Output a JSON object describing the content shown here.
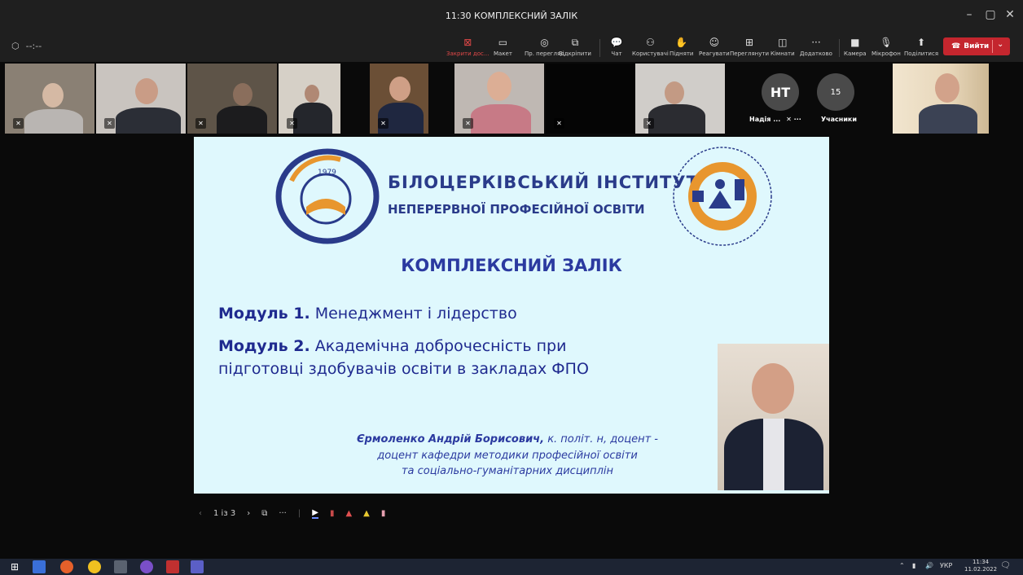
{
  "window": {
    "title": "11:30 КОМПЛЕКСНИЙ ЗАЛІК"
  },
  "toolbar": {
    "timer": "--:--",
    "buttons": [
      {
        "label": "Закрити дос...",
        "icon": "close-share-icon"
      },
      {
        "label": "Макет",
        "icon": "layout-icon"
      },
      {
        "label": "Пр. перегляд",
        "icon": "eye-icon"
      },
      {
        "label": "Відкріпити",
        "icon": "unpin-icon"
      },
      {
        "label": "Чат",
        "icon": "chat-icon"
      },
      {
        "label": "Користувачі",
        "icon": "people-icon"
      },
      {
        "label": "Підняти",
        "icon": "raise-hand-icon"
      },
      {
        "label": "Реагувати",
        "icon": "smile-icon"
      },
      {
        "label": "Переглянути",
        "icon": "view-icon"
      },
      {
        "label": "Кімнати",
        "icon": "rooms-icon"
      },
      {
        "label": "Додатково",
        "icon": "more-icon"
      },
      {
        "label": "Камера",
        "icon": "camera-icon"
      },
      {
        "label": "Мікрофон",
        "icon": "microphone-icon"
      },
      {
        "label": "Поділитися",
        "icon": "share-icon"
      }
    ],
    "leave": "Вийти"
  },
  "participants": {
    "avatar_initials": "НТ",
    "avatar_name": "Надія ...",
    "count": "15",
    "count_label": "Учасники"
  },
  "slide": {
    "institute_line1": "БІЛОЦЕРКІВСЬКИЙ  ІНСТИТУТ",
    "institute_line2": "НЕПЕРЕРВНОЇ ПРОФЕСІЙНОЇ ОСВІТИ",
    "logo_year": "1979",
    "heading": "КОМПЛЕКСНИЙ ЗАЛІК",
    "module1_num": "Модуль 1.",
    "module1_text": " Менеджмент і лідерство",
    "module2_num": "Модуль 2.",
    "module2_text": " Академічна доброчесність при",
    "module2_line2": "підготовці здобувачів освіти в закладах ФПО",
    "author_name": "Єрмоленко Андрій Борисович,",
    "author_title": " к. політ. н, доцент -",
    "author_line2": "доцент кафедри методики професійної освіти",
    "author_line3": "та соціально-гуманітарних дисциплін"
  },
  "slide_controls": {
    "page": "1 із 3"
  },
  "taskbar": {
    "lang": "УКР",
    "time": "11:34",
    "date": "11.02.2022"
  },
  "colors": {
    "accent": "#2b3aa0",
    "leave": "#c4262e",
    "slide_bg": "#dff8fd"
  }
}
